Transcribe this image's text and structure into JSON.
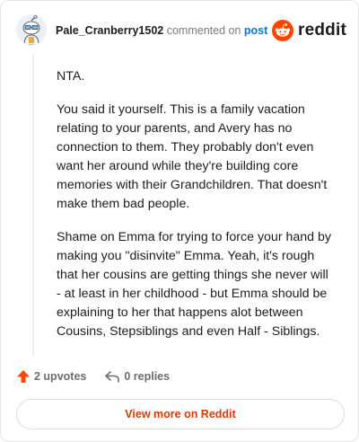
{
  "header": {
    "username": "Pale_Cranberry1502",
    "commented_text": "commented on",
    "post_link": "post",
    "brand_name": "reddit"
  },
  "comment": {
    "paragraphs": [
      "NTA.",
      "You said it yourself. This is a family vacation relating to your parents, and Avery has no connection to them. They probably don't even want her around while they're building core memories with their Grandchildren. That doesn't make them bad people.",
      "Shame on Emma for trying to force your hand by making you \"disinvite\" Emma. Yeah, it's rough that her cousins are getting things she never will - at least in her childhood - but Emma should be explaining to her that happens alot between Cousins, Stepsiblings and even Half - Siblings."
    ]
  },
  "actions": {
    "upvotes": "2 upvotes",
    "replies": "0 replies"
  },
  "view_more_label": "View more on Reddit",
  "colors": {
    "accent": "#d93a00",
    "upvote": "#ff4500",
    "link": "#0079d3",
    "muted": "#787c7e"
  },
  "icons": [
    "avatar",
    "reddit-logo-icon",
    "upvote-arrow-icon",
    "reply-icon"
  ]
}
